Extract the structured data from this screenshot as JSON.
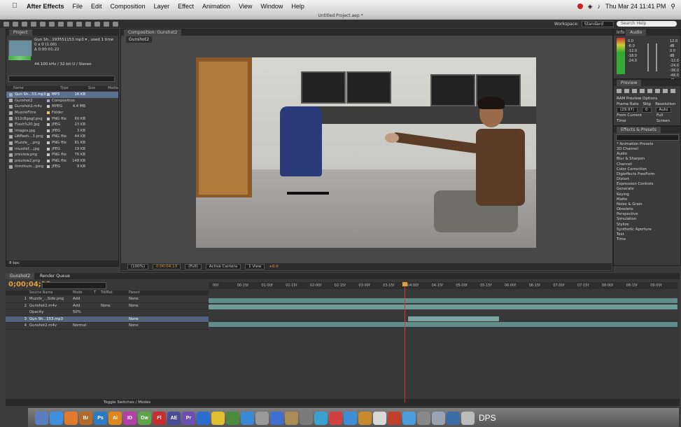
{
  "menubar": {
    "app_name": "After Effects",
    "menus": [
      "File",
      "Edit",
      "Composition",
      "Layer",
      "Effect",
      "Animation",
      "View",
      "Window",
      "Help"
    ],
    "datetime": "Thu Mar 24 11:41 PM"
  },
  "window_title": "Untitled Project.aep *",
  "toolbar": {
    "workspace_label": "Workspace:",
    "workspace_value": "Standard",
    "search_placeholder": "Search Help"
  },
  "project_panel": {
    "tab": "Project",
    "selected_name": "Gun Sh...193551153.mp3 ▾ , used 1 time",
    "info_lines": [
      "0 x 0 (1.00)",
      "Δ 0:00:01:22",
      "44.100 kHz / 32 bit U / Stereo"
    ],
    "columns": [
      "Name",
      "Type",
      "Size",
      "Media"
    ],
    "items": [
      {
        "name": "Gun Sh...53.mp3",
        "type": "MP3",
        "size": "16 KB",
        "color": "#c9c9c9",
        "selected": true
      },
      {
        "name": "Gunshot2",
        "type": "Composition",
        "size": "",
        "color": "#a9a2d4",
        "selected": false
      },
      {
        "name": "Gunshot2.m4v",
        "type": "MPEG",
        "size": "4.4 MB",
        "color": "#c9c9c9",
        "selected": false
      },
      {
        "name": "MuzzleFlms",
        "type": "Folder",
        "size": "",
        "color": "#e7c66a",
        "selected": false
      },
      {
        "name": "912c8gogf.png",
        "type": "PNG file",
        "size": "60 KB",
        "color": "#c9c9c9",
        "selected": false
      },
      {
        "name": "Flash%20.jpg",
        "type": "JPEG",
        "size": "23 KB",
        "color": "#c9c9c9",
        "selected": false
      },
      {
        "name": "images.jpg",
        "type": "JPEG",
        "size": "3 KB",
        "color": "#c9c9c9",
        "selected": false
      },
      {
        "name": "LWflash...3.png",
        "type": "PNG file",
        "size": "44 KB",
        "color": "#c9c9c9",
        "selected": false
      },
      {
        "name": "Muzzle_...png",
        "type": "PNG file",
        "size": "81 KB",
        "color": "#c9c9c9",
        "selected": false
      },
      {
        "name": "muzzlef....jpg",
        "type": "JPEG",
        "size": "19 KB",
        "color": "#c9c9c9",
        "selected": false
      },
      {
        "name": "preview.png",
        "type": "PNG file",
        "size": "76 KB",
        "color": "#c9c9c9",
        "selected": false
      },
      {
        "name": "preview2.png",
        "type": "PNG file",
        "size": "148 KB",
        "color": "#c9c9c9",
        "selected": false
      },
      {
        "name": "thmthum...jpeg",
        "type": "JPEG",
        "size": "9 KB",
        "color": "#c9c9c9",
        "selected": false
      }
    ],
    "footer": "8 bpc"
  },
  "composition_panel": {
    "tab": "Composition: Gunshot2",
    "sub_tab": "Gunshot2",
    "zoom": "(100%)",
    "timecode": "0;00;04;13",
    "resolution": "(Full)",
    "camera": "Active Camera",
    "views": "1 View",
    "offset": "+0.0"
  },
  "audio_panel": {
    "tabs": [
      "Info",
      "Audio"
    ],
    "left_labels": [
      "0.0",
      "-6.0",
      "-12.0",
      "-18.0",
      "-24.0"
    ],
    "right_labels": [
      "12.0 dB",
      "0.0 dB",
      "-12.0",
      "-24.0",
      "-36.0",
      "-48.0 dB"
    ]
  },
  "preview_panel": {
    "tab": "Preview",
    "ram_options": "RAM Preview Options",
    "frame_rate_label": "Frame Rate",
    "skip_label": "Skip",
    "resolution_label": "Resolution",
    "frame_rate_value": "(29.97)",
    "skip_value": "0",
    "resolution_value": "Auto",
    "from_current": "From Current Time",
    "full_screen": "Full Screen"
  },
  "effects_panel": {
    "tab": "Effects & Presets",
    "items": [
      "* Animation Presets",
      "3D Channel",
      "Audio",
      "Blur & Sharpen",
      "Channel",
      "Color Correction",
      "Digieffects FreeForm",
      "Distort",
      "Expression Controls",
      "Generate",
      "Keying",
      "Matte",
      "Noise & Grain",
      "Obsolete",
      "Perspective",
      "Simulation",
      "Stylize",
      "Synthetic Aperture",
      "Text",
      "Time"
    ]
  },
  "timeline": {
    "tabs": [
      "Gunshot2",
      "Render Queue"
    ],
    "current_time": "0;00;04;13",
    "columns": [
      "Source Name",
      "Mode",
      "T",
      "TrkMat",
      "Parent"
    ],
    "layers": [
      {
        "num": "1",
        "name": "Muzzle_...Side.png",
        "mode": "Add",
        "trkmat": "",
        "parent": "None",
        "selected": false
      },
      {
        "num": "2",
        "name": "Gunshot2.m4v",
        "mode": "Add",
        "trkmat": "None",
        "parent": "None",
        "selected": false
      },
      {
        "num": "",
        "name": "Opacity",
        "mode": "50%",
        "trkmat": "",
        "parent": "",
        "selected": false
      },
      {
        "num": "3",
        "name": "Gun Sh...153.mp3",
        "mode": "",
        "trkmat": "",
        "parent": "None",
        "selected": true
      },
      {
        "num": "4",
        "name": "Gunshot2.m4v",
        "mode": "Normal",
        "trkmat": "",
        "parent": "None",
        "selected": false
      }
    ],
    "ruler_ticks": [
      "00f",
      "00:15f",
      "01:00f",
      "01:15f",
      "02:00f",
      "02:15f",
      "03:00f",
      "03:15f",
      "04:00f",
      "04:15f",
      "05:00f",
      "05:15f",
      "06:00f",
      "06:15f",
      "07:00f",
      "07:15f",
      "08:00f",
      "08:15f",
      "09:00f"
    ],
    "footer": "Toggle Switches / Modes"
  },
  "dock": {
    "apps": [
      {
        "label": "",
        "color": "#5a7fc1"
      },
      {
        "label": "",
        "color": "#3f8fe0"
      },
      {
        "label": "",
        "color": "#e07a2c"
      },
      {
        "label": "Br",
        "color": "#b36a2b"
      },
      {
        "label": "Ps",
        "color": "#2a7bc4"
      },
      {
        "label": "Ai",
        "color": "#e0861e"
      },
      {
        "label": "ID",
        "color": "#b63ea8"
      },
      {
        "label": "Dw",
        "color": "#5ea44a"
      },
      {
        "label": "Fl",
        "color": "#c43030"
      },
      {
        "label": "AE",
        "color": "#4a4b9a"
      },
      {
        "label": "Pr",
        "color": "#6b4fb5"
      },
      {
        "label": "",
        "color": "#2a6cd0"
      },
      {
        "label": "",
        "color": "#e0c030"
      },
      {
        "label": "",
        "color": "#4c8a3c"
      },
      {
        "label": "",
        "color": "#3a8ad6"
      },
      {
        "label": "",
        "color": "#9a9a9a"
      },
      {
        "label": "",
        "color": "#3f6fd0"
      },
      {
        "label": "",
        "color": "#aa8c55"
      },
      {
        "label": "",
        "color": "#7a7a7a"
      },
      {
        "label": "",
        "color": "#3aa0d0"
      },
      {
        "label": "",
        "color": "#d04040"
      },
      {
        "label": "",
        "color": "#3d8ed6"
      },
      {
        "label": "",
        "color": "#c88a2c"
      },
      {
        "label": "",
        "color": "#d8d8d8"
      },
      {
        "label": "",
        "color": "#c0402a"
      },
      {
        "label": "",
        "color": "#4a9ee0"
      },
      {
        "label": "",
        "color": "#888888"
      },
      {
        "label": "",
        "color": "#9aa4b0"
      },
      {
        "label": "",
        "color": "#3b6ea8"
      },
      {
        "label": "",
        "color": "#bbbbbb"
      }
    ],
    "trailing_text": "DPS"
  }
}
